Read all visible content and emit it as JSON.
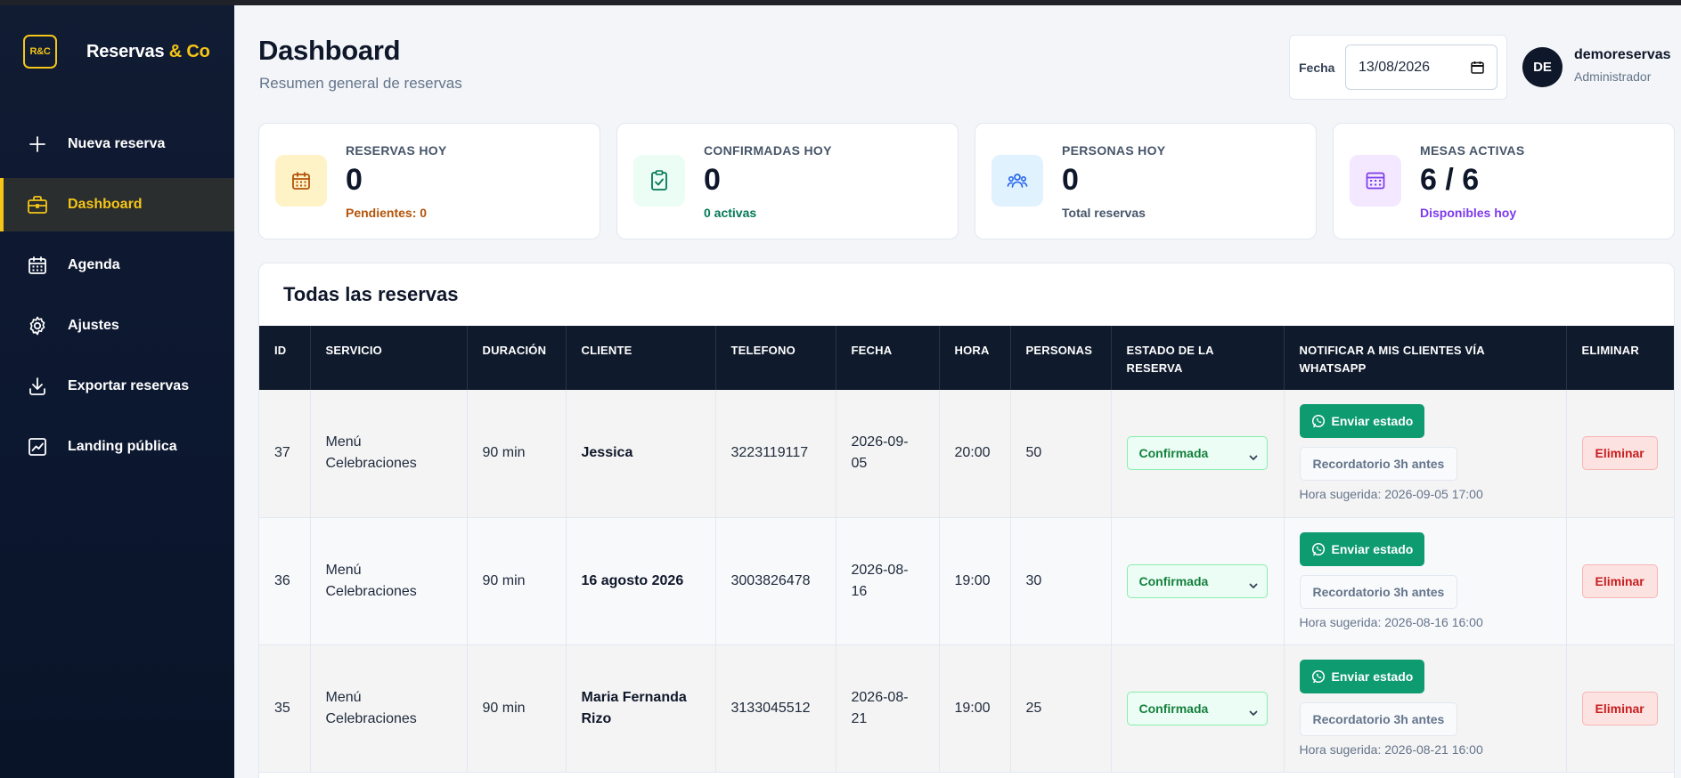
{
  "brand": {
    "logo": "R&C",
    "name_main": "Reservas ",
    "name_accent": "& Co"
  },
  "sidebar": {
    "items": [
      {
        "label": "Nueva reserva",
        "icon": "plus-icon",
        "active": false
      },
      {
        "label": "Dashboard",
        "icon": "briefcase-icon",
        "active": true
      },
      {
        "label": "Agenda",
        "icon": "calendar-icon",
        "active": false
      },
      {
        "label": "Ajustes",
        "icon": "gear-icon",
        "active": false
      },
      {
        "label": "Exportar reservas",
        "icon": "download-icon",
        "active": false
      },
      {
        "label": "Landing pública",
        "icon": "chart-icon",
        "active": false
      }
    ]
  },
  "header": {
    "title": "Dashboard",
    "subtitle": "Resumen general de reservas",
    "date_label": "Fecha",
    "date_value": "13/08/2026",
    "user": {
      "initials": "DE",
      "name": "demoreservas",
      "role": "Administrador"
    }
  },
  "stats": [
    {
      "label": "RESERVAS HOY",
      "value": "0",
      "sub": "Pendientes: 0",
      "icon": "calendar-icon",
      "color": "#b45309",
      "icon_bg": "#fef3c7"
    },
    {
      "label": "CONFIRMADAS HOY",
      "value": "0",
      "sub": "0 activas",
      "icon": "clipboard-check-icon",
      "color": "#047857",
      "icon_bg": "#ecfdf5"
    },
    {
      "label": "PERSONAS HOY",
      "value": "0",
      "sub": "Total reservas",
      "icon": "users-icon",
      "color": "#475569",
      "icon_bg": "#e0f2fe"
    },
    {
      "label": "MESAS ACTIVAS",
      "value": "6 / 6",
      "sub": "Disponibles hoy",
      "icon": "calculator-icon",
      "color": "#7c3aed",
      "icon_bg": "#f3e8ff"
    }
  ],
  "table": {
    "title": "Todas las reservas",
    "columns": [
      "ID",
      "SERVICIO",
      "DURACIÓN",
      "CLIENTE",
      "TELEFONO",
      "FECHA",
      "HORA",
      "PERSONAS",
      "ESTADO DE LA RESERVA",
      "NOTIFICAR A MIS CLIENTES VÍA WHATSAPP",
      "ELIMINAR"
    ],
    "rows": [
      {
        "id": "37",
        "servicio": "Menú Celebraciones",
        "duracion": "90 min",
        "cliente": "Jessica",
        "telefono": "3223119117",
        "fecha": "2026-09-05",
        "hora": "20:00",
        "personas": "50",
        "estado": "Confirmada",
        "wa_label": "Enviar estado",
        "remind_label": "Recordatorio 3h antes",
        "sugerida": "Hora sugerida: 2026-09-05 17:00",
        "delete_label": "Eliminar"
      },
      {
        "id": "36",
        "servicio": "Menú Celebraciones",
        "duracion": "90 min",
        "cliente": "16 agosto 2026",
        "telefono": "3003826478",
        "fecha": "2026-08-16",
        "hora": "19:00",
        "personas": "30",
        "estado": "Confirmada",
        "wa_label": "Enviar estado",
        "remind_label": "Recordatorio 3h antes",
        "sugerida": "Hora sugerida: 2026-08-16 16:00",
        "delete_label": "Eliminar"
      },
      {
        "id": "35",
        "servicio": "Menú Celebraciones",
        "duracion": "90 min",
        "cliente": "Maria Fernanda Rizo",
        "telefono": "3133045512",
        "fecha": "2026-08-21",
        "hora": "19:00",
        "personas": "25",
        "estado": "Confirmada",
        "wa_label": "Enviar estado",
        "remind_label": "Recordatorio 3h antes",
        "sugerida": "Hora sugerida: 2026-08-21 16:00",
        "delete_label": "Eliminar"
      }
    ]
  },
  "colors": {
    "accent": "#f5c518",
    "sidebar_bg": "#0c1730",
    "table_header_bg": "#0f1a2c",
    "whatsapp": "#0e9b6f",
    "danger": "#c81e1e"
  }
}
